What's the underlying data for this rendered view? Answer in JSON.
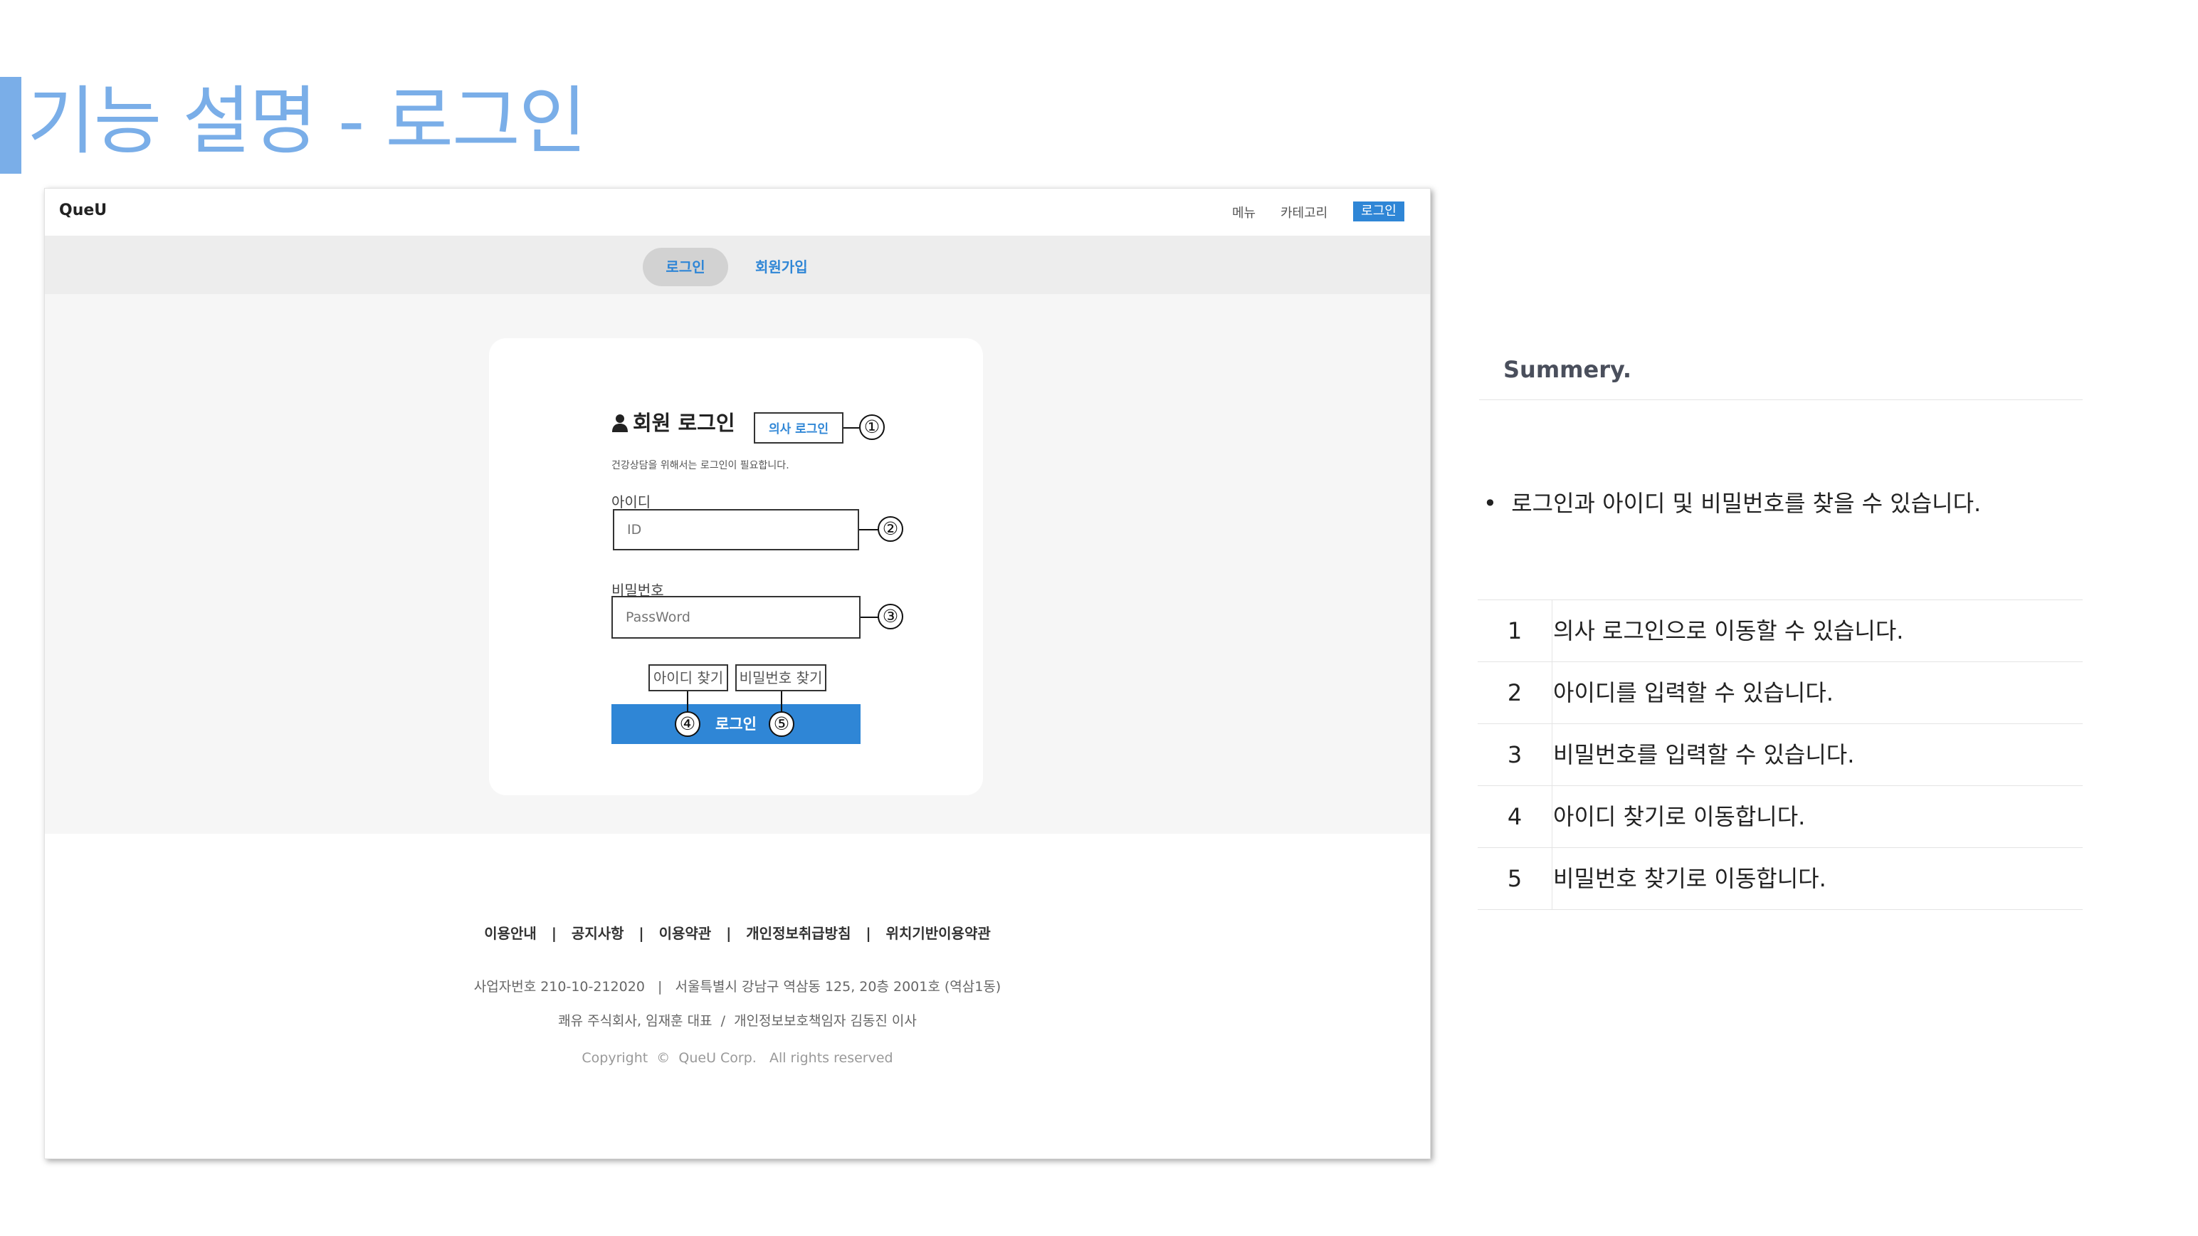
{
  "slide": {
    "title": "기능 설명 - 로그인"
  },
  "mock": {
    "nav": {
      "brand": "QueU",
      "menu": "메뉴",
      "category": "카테고리",
      "login": "로그인"
    },
    "tabs": {
      "login": "로그인",
      "signup": "회원가입"
    },
    "login": {
      "heading": "회원 로그인",
      "doctor_button": "의사 로그인",
      "subtitle": "건강상담을 위해서는 로그인이 필요합니다.",
      "id_label": "아이디",
      "id_placeholder": "ID",
      "pw_label": "비밀번호",
      "pw_placeholder": "PassWord",
      "find_id": "아이디 찾기",
      "find_pw": "비밀번호 찾기",
      "submit": "로그인"
    },
    "callouts": [
      "①",
      "②",
      "③",
      "④",
      "⑤"
    ],
    "footer": {
      "links": "이용안내   |   공지사항   |   이용약관   |   개인정보취급방침   |   위치기반이용약관",
      "business": "사업자번호 210-10-212020   |   서울특별시 강남구 역삼동 125, 20층 2001호 (역삼1동)",
      "company": "쾌유 주식회사, 임재훈 대표  /  개인정보보호책임자 김동진 이사",
      "copyright": "Copyright  ©  QueU Corp.   All rights reserved"
    }
  },
  "summary": {
    "heading": "Summery.",
    "bullet": "로그인과 아이디 및 비밀번호를 찾을 수 있습니다.",
    "rows": [
      {
        "num": "1",
        "desc": "의사 로그인으로 이동할 수 있습니다."
      },
      {
        "num": "2",
        "desc": "아이디를 입력할 수 있습니다."
      },
      {
        "num": "3",
        "desc": "비밀번호를 입력할 수 있습니다."
      },
      {
        "num": "4",
        "desc": "아이디 찾기로 이동합니다."
      },
      {
        "num": "5",
        "desc": "비밀번호 찾기로 이동합니다."
      }
    ]
  },
  "colors": {
    "accent": "#7aaee8",
    "brand_blue": "#2f86d6",
    "band_gray": "#f6f6f6"
  }
}
